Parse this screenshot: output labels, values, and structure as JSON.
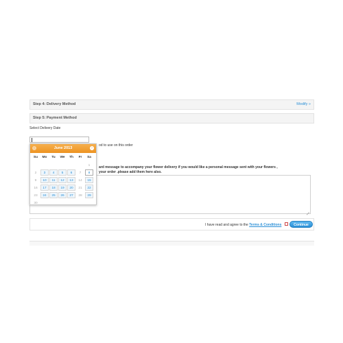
{
  "step4": {
    "title": "Step 4: Delivery Method",
    "modify": "Modify »"
  },
  "step5": {
    "title": "Step 5: Payment Method"
  },
  "delivery_date_label": "Select Delivery Date",
  "payment_method_text": "od to use on this order",
  "message_line1": "ard message to accompany your flower delivery if you would like a personal message sent with your flowers ,",
  "message_line2": "your order .please add them here also.",
  "agree_text": "I have read and agree to the",
  "terms_link": "Terms & Conditions",
  "continue_label": "Continue",
  "datepicker": {
    "month_label": "June 2013",
    "prev_label": "‹",
    "next_label": "›",
    "weekdays": [
      "Su",
      "Mo",
      "Tu",
      "We",
      "Th",
      "Fr",
      "Sa"
    ],
    "weeks": [
      [
        "",
        "",
        "",
        "",
        "",
        "",
        "1"
      ],
      [
        "2",
        "3",
        "4",
        "5",
        "6",
        "7",
        "8"
      ],
      [
        "9",
        "10",
        "11",
        "12",
        "13",
        "14",
        "15"
      ],
      [
        "16",
        "17",
        "18",
        "19",
        "20",
        "21",
        "22"
      ],
      [
        "23",
        "24",
        "25",
        "26",
        "27",
        "28",
        "29"
      ],
      [
        "30",
        "",
        "",
        "",
        "",
        "",
        ""
      ]
    ],
    "disabled_days": [
      "1",
      "2",
      "7",
      "9",
      "14",
      "16",
      "21",
      "23",
      "28",
      "30"
    ]
  }
}
